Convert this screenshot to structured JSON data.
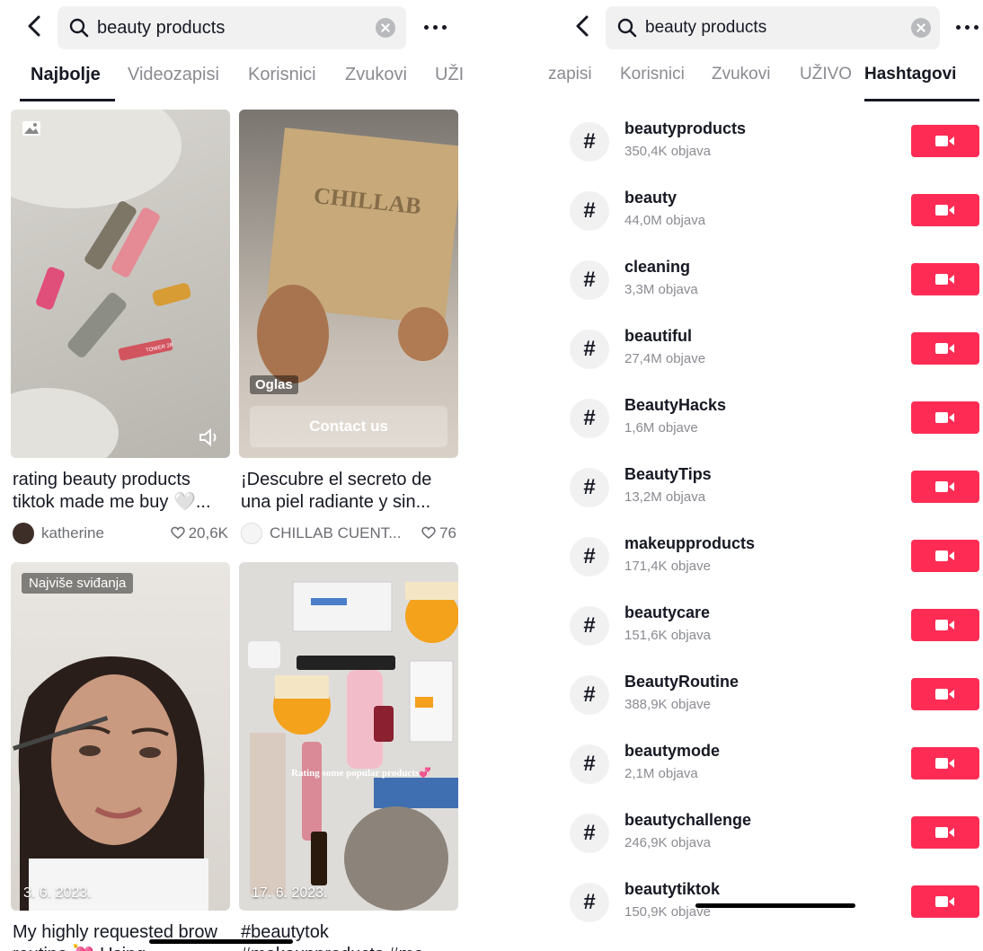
{
  "left": {
    "search": {
      "query": "beauty products"
    },
    "tabs": [
      "Najbolje",
      "Videozapisi",
      "Korisnici",
      "Zvukovi",
      "UŽI"
    ],
    "cards": [
      {
        "caption": "rating beauty products tiktok made me buy 🤍...",
        "author": "katherine",
        "likes": "20,6K",
        "type": "photo"
      },
      {
        "caption": "¡Descubre el secreto de una piel radiante y sin...",
        "author": "CHILLAB CUENT...",
        "likes": "76",
        "ad_label": "Oglas",
        "cta": "Contact us",
        "product_text": "CHILLAB"
      },
      {
        "caption": "My highly requested brow routine 💘 Using",
        "badge": "Najviše sviđanja",
        "date": "3. 6. 2023."
      },
      {
        "caption": "#beautytok #makeupproducts #me",
        "date": "17. 6. 2023.",
        "overlay": "Rating some popular products💞"
      }
    ]
  },
  "right": {
    "search": {
      "query": "beauty products"
    },
    "tabs": [
      "zapisi",
      "Korisnici",
      "Zvukovi",
      "UŽIVO",
      "Hashtagovi"
    ],
    "hashtags": [
      {
        "name": "beautyproducts",
        "count": "350,4K objava"
      },
      {
        "name": "beauty",
        "count": "44,0M objava"
      },
      {
        "name": "cleaning",
        "count": "3,3M objava"
      },
      {
        "name": "beautiful",
        "count": "27,4M objave"
      },
      {
        "name": "BeautyHacks",
        "count": "1,6M objave"
      },
      {
        "name": "BeautyTips",
        "count": "13,2M objava"
      },
      {
        "name": "makeupproducts",
        "count": "171,4K objave"
      },
      {
        "name": "beautycare",
        "count": "151,6K objava"
      },
      {
        "name": "BeautyRoutine",
        "count": "388,9K objave"
      },
      {
        "name": "beautymode",
        "count": "2,1M objava"
      },
      {
        "name": "beautychallenge",
        "count": "246,9K objava"
      },
      {
        "name": "beautytiktok",
        "count": "150,9K objave"
      }
    ]
  },
  "colors": {
    "accent": "#fe2c55",
    "text": "#161823",
    "muted": "#8a8b91"
  },
  "icons": [
    "back-icon",
    "search-icon",
    "clear-icon",
    "more-icon",
    "hashtag-icon",
    "video-camera-icon",
    "heart-icon",
    "sound-icon",
    "photo-icon"
  ]
}
